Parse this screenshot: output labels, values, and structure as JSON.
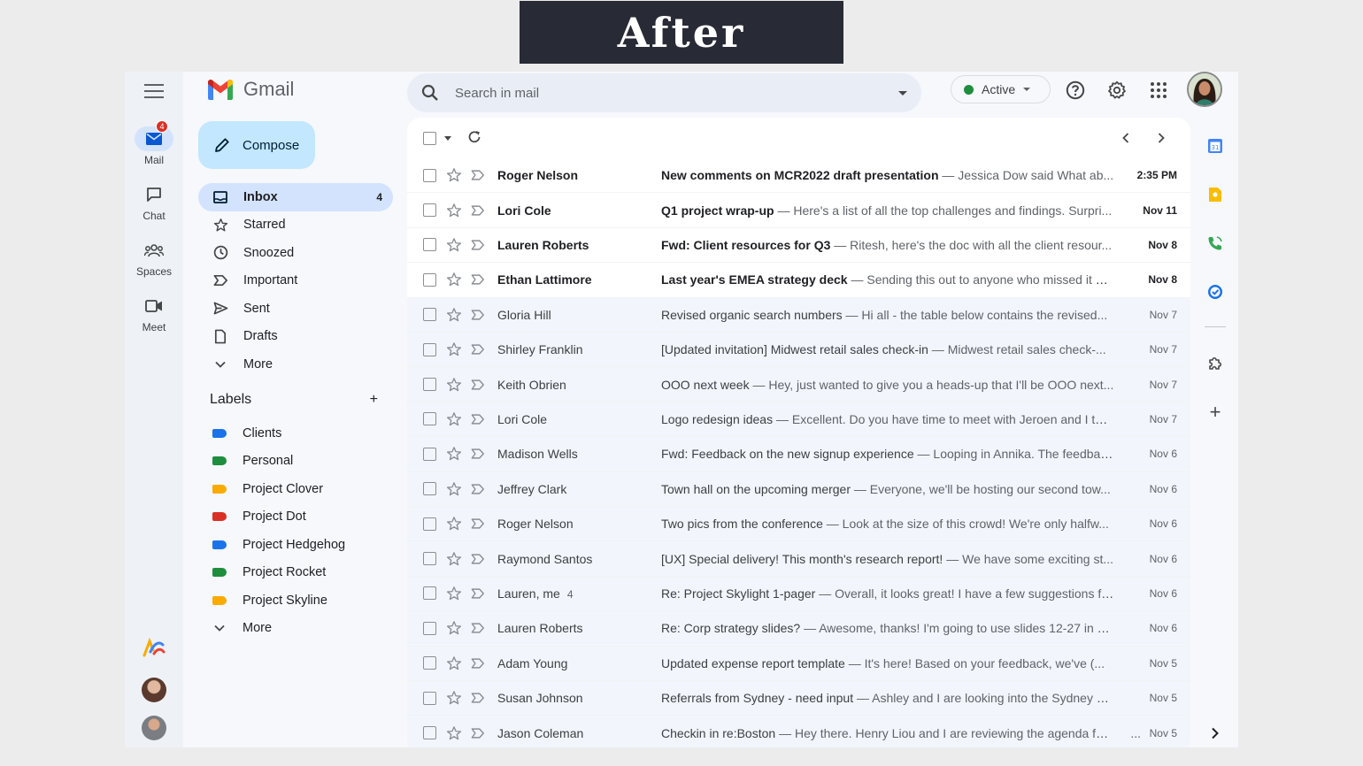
{
  "banner": {
    "title": "After"
  },
  "app": {
    "name": "Gmail"
  },
  "rail": {
    "mail": {
      "label": "Mail",
      "badge": "4"
    },
    "chat": {
      "label": "Chat"
    },
    "spaces": {
      "label": "Spaces"
    },
    "meet": {
      "label": "Meet"
    }
  },
  "compose": {
    "label": "Compose"
  },
  "nav": [
    {
      "label": "Inbox",
      "count": "4",
      "icon": "inbox-icon"
    },
    {
      "label": "Starred",
      "icon": "star-icon"
    },
    {
      "label": "Snoozed",
      "icon": "clock-icon"
    },
    {
      "label": "Important",
      "icon": "important-icon"
    },
    {
      "label": "Sent",
      "icon": "send-icon"
    },
    {
      "label": "Drafts",
      "icon": "draft-icon"
    },
    {
      "label": "More",
      "icon": "chevron-down-icon"
    }
  ],
  "labels": {
    "title": "Labels",
    "items": [
      {
        "label": "Clients",
        "color": "#1a73e8"
      },
      {
        "label": "Personal",
        "color": "#1e8e3e"
      },
      {
        "label": "Project Clover",
        "color": "#f9ab00"
      },
      {
        "label": "Project Dot",
        "color": "#d93025"
      },
      {
        "label": "Project Hedgehog",
        "color": "#1a73e8"
      },
      {
        "label": "Project Rocket",
        "color": "#1e8e3e"
      },
      {
        "label": "Project Skyline",
        "color": "#f9ab00"
      }
    ],
    "more": "More"
  },
  "search": {
    "placeholder": "Search in mail"
  },
  "status": {
    "label": "Active",
    "color": "#1e8e3e"
  },
  "emails": [
    {
      "sender": "Roger Nelson",
      "subject": "New comments on MCR2022 draft presentation",
      "snippet": " — Jessica Dow said What ab...",
      "date": "2:35 PM",
      "unread": true
    },
    {
      "sender": "Lori Cole",
      "subject": "Q1 project wrap-up",
      "snippet": " — Here's a list of all the top challenges and findings. Surpri...",
      "date": "Nov 11",
      "unread": true
    },
    {
      "sender": "Lauren Roberts",
      "subject": "Fwd: Client resources for Q3",
      "snippet": " — Ritesh, here's the doc with all the client resour...",
      "date": "Nov 8",
      "unread": true
    },
    {
      "sender": "Ethan Lattimore",
      "subject": "Last year's EMEA strategy deck",
      "snippet": " — Sending this out to anyone who missed it R...",
      "date": "Nov 8",
      "unread": true
    },
    {
      "sender": "Gloria Hill",
      "subject": "Revised organic search numbers",
      "snippet": " — Hi all - the table below contains the revised...",
      "date": "Nov 7",
      "unread": false
    },
    {
      "sender": "Shirley Franklin",
      "subject": "[Updated invitation] Midwest retail sales check-in",
      "snippet": " — Midwest retail sales check-...",
      "date": "Nov 7",
      "unread": false
    },
    {
      "sender": "Keith Obrien",
      "subject": "OOO next week",
      "snippet": " — Hey, just wanted to give you a heads-up that I'll be OOO next...",
      "date": "Nov 7",
      "unread": false
    },
    {
      "sender": "Lori Cole",
      "subject": "Logo redesign ideas",
      "snippet": " — Excellent. Do you have time to meet with Jeroen and I thi...",
      "date": "Nov 7",
      "unread": false
    },
    {
      "sender": "Madison Wells",
      "subject": "Fwd: Feedback on the new signup experience",
      "snippet": " — Looping in Annika. The feedbac...",
      "date": "Nov 6",
      "unread": false
    },
    {
      "sender": "Jeffrey Clark",
      "subject": "Town hall on the upcoming merger",
      "snippet": " — Everyone, we'll be hosting our second tow...",
      "date": "Nov 6",
      "unread": false
    },
    {
      "sender": "Roger Nelson",
      "subject": "Two pics from the conference",
      "snippet": " — Look at the size of this crowd! We're only halfw...",
      "date": "Nov 6",
      "unread": false
    },
    {
      "sender": "Raymond Santos",
      "subject": "[UX] Special delivery! This month's research report!",
      "snippet": " — We have some exciting st...",
      "date": "Nov 6",
      "unread": false
    },
    {
      "sender": "Lauren, me",
      "count": "4",
      "subject": "Re: Project Skylight 1-pager",
      "snippet": " — Overall, it looks great! I have a few suggestions fo...",
      "date": "Nov 6",
      "unread": false
    },
    {
      "sender": "Lauren Roberts",
      "subject": "Re: Corp strategy slides?",
      "snippet": " — Awesome, thanks! I'm going to use slides 12-27 in m...",
      "date": "Nov 6",
      "unread": false
    },
    {
      "sender": "Adam Young",
      "subject": "Updated expense report template",
      "snippet": " — It's here! Based on your feedback, we've (...",
      "date": "Nov 5",
      "unread": false
    },
    {
      "sender": "Susan Johnson",
      "subject": "Referrals from Sydney - need input",
      "snippet": " — Ashley and I are looking into the Sydney m...",
      "date": "Nov 5",
      "unread": false
    },
    {
      "sender": "Jason Coleman",
      "subject": "Checkin in re:Boston",
      "snippet": " — Hey there. Henry Liou and I are reviewing the agenda for...",
      "extra": "...",
      "date": "Nov 5",
      "unread": false
    }
  ]
}
